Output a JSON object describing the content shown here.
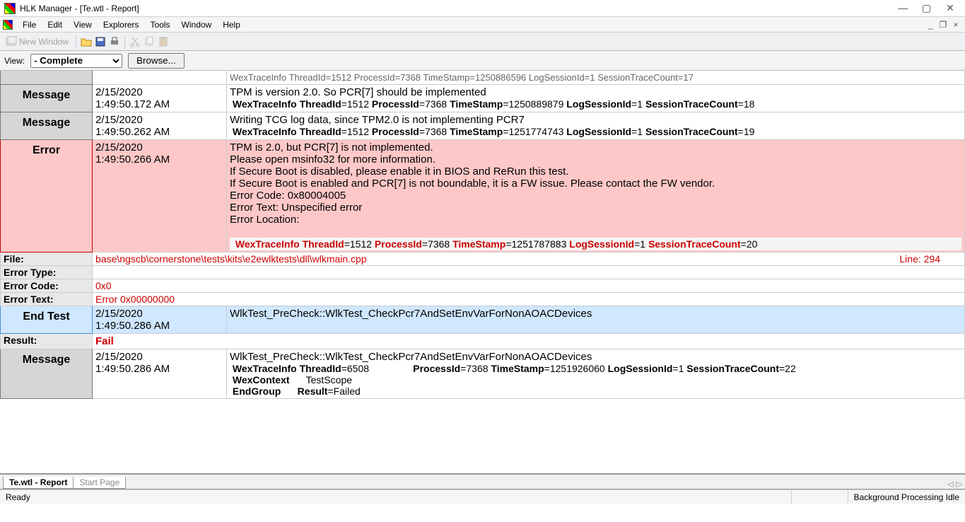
{
  "window": {
    "title": "HLK Manager - [Te.wtl - Report]"
  },
  "menu": [
    "File",
    "Edit",
    "View",
    "Explorers",
    "Tools",
    "Window",
    "Help"
  ],
  "toolbar": {
    "newwin": "New Window"
  },
  "filter": {
    "view_label": "View:",
    "selected": "- Complete",
    "browse": "Browse..."
  },
  "partial": "WexTraceInfo ThreadId=1512 ProcessId=7368 TimeStamp=1250886596 LogSessionId=1 SessionTraceCount=17",
  "rows": [
    {
      "type": "Message",
      "date": "2/15/2020",
      "time": "1:49:50.172 AM",
      "msg": "TPM is version 2.0. So PCR[7] should be implemented",
      "trace": {
        "thread": "1512",
        "proc": "7368",
        "ts": "1250889879",
        "sid": "1",
        "cnt": "18"
      }
    },
    {
      "type": "Message",
      "date": "2/15/2020",
      "time": "1:49:50.262 AM",
      "msg": "Writing TCG log data, since TPM2.0 is not implementing PCR7",
      "trace": {
        "thread": "1512",
        "proc": "7368",
        "ts": "1251774743",
        "sid": "1",
        "cnt": "19"
      }
    }
  ],
  "error": {
    "type": "Error",
    "date": "2/15/2020",
    "time": "1:49:50.266 AM",
    "lines": [
      "TPM is 2.0, but PCR[7] is not implemented.",
      "Please open msinfo32 for more information.",
      "If Secure Boot is disabled, please enable it in BIOS and ReRun this test.",
      "If Secure Boot is enabled and PCR[7] is not boundable, it is a FW issue. Please contact the FW vendor.",
      "Error Code: 0x80004005",
      "Error Text: Unspecified error",
      "Error Location:"
    ],
    "trace": {
      "thread": "1512",
      "proc": "7368",
      "ts": "1251787883",
      "sid": "1",
      "cnt": "20"
    }
  },
  "details": {
    "file_label": "File:",
    "file": "base\\ngscb\\cornerstone\\tests\\kits\\e2ewlktests\\dll\\wlkmain.cpp",
    "line_label": "Line:",
    "line": "294",
    "etype_label": "Error Type:",
    "etype": "",
    "ecode_label": "Error Code:",
    "ecode": "0x0",
    "etext_label": "Error Text:",
    "etext": "Error 0x00000000"
  },
  "endtest": {
    "type": "End Test",
    "date": "2/15/2020",
    "time": "1:49:50.286 AM",
    "msg": "WlkTest_PreCheck::WlkTest_CheckPcr7AndSetEnvVarForNonAOACDevices"
  },
  "result": {
    "label": "Result:",
    "value": "Fail"
  },
  "msg3": {
    "type": "Message",
    "date": "2/15/2020",
    "time": "1:49:50.286 AM",
    "msg": "WlkTest_PreCheck::WlkTest_CheckPcr7AndSetEnvVarForNonAOACDevices",
    "trace": {
      "thread": "6508",
      "proc": "7368",
      "ts": "1251926060",
      "sid": "1",
      "cnt": "22"
    },
    "wexcontext_l": "WexContext",
    "wexcontext_v": "TestScope",
    "endgroup_l": "EndGroup",
    "result_l": "Result",
    "result_v": "Failed"
  },
  "tabs": {
    "active": "Te.wtl - Report",
    "inactive": "Start Page"
  },
  "status": {
    "ready": "Ready",
    "bg": "Background Processing Idle"
  }
}
